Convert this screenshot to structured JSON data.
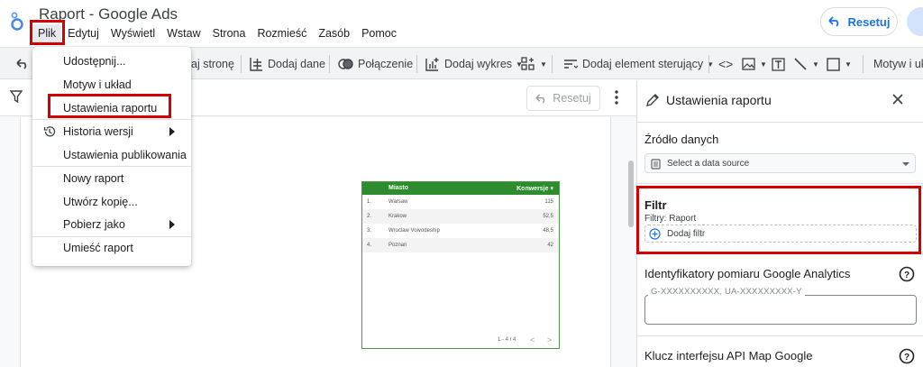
{
  "app": {
    "title": "Raport - Google Ads",
    "reset_label": "Resetuj"
  },
  "menubar": [
    "Plik",
    "Edytuj",
    "Wyświetl",
    "Wstaw",
    "Strona",
    "Rozmieść",
    "Zasób",
    "Pomoc"
  ],
  "toolbar": {
    "add_page": "aj stronę",
    "add_data": "Dodaj dane",
    "connection": "Połączenie",
    "add_chart": "Dodaj wykres",
    "add_control": "Dodaj element sterujący",
    "theme": "Motyw i ukł"
  },
  "canvas": {
    "reset_label": "Resetuj"
  },
  "file_menu": {
    "items": [
      {
        "label": "Udostępnij...",
        "submenu": false,
        "icon": ""
      },
      {
        "label": "Motyw i układ",
        "submenu": false,
        "icon": ""
      },
      {
        "label": "Ustawienia raportu",
        "submenu": false,
        "icon": ""
      },
      {
        "label": "Historia wersji",
        "submenu": true,
        "icon": "history-icon"
      },
      {
        "label": "Ustawienia publikowania",
        "submenu": false,
        "icon": ""
      },
      {
        "label": "Nowy raport",
        "submenu": false,
        "icon": ""
      },
      {
        "label": "Utwórz kopię...",
        "submenu": false,
        "icon": ""
      },
      {
        "label": "Pobierz jako",
        "submenu": true,
        "icon": ""
      },
      {
        "label": "Umieść raport",
        "submenu": false,
        "icon": ""
      }
    ]
  },
  "table": {
    "headers": [
      "Miasto",
      "Konwersje"
    ],
    "rows": [
      {
        "no": "1.",
        "city": "Warsaw",
        "value": "115"
      },
      {
        "no": "2.",
        "city": "Krakow",
        "value": "52,5"
      },
      {
        "no": "3.",
        "city": "Wroclaw Voivodeship",
        "value": "48,5"
      },
      {
        "no": "4.",
        "city": "Poznan",
        "value": "42"
      }
    ],
    "pager": "1 - 4 / 4",
    "accent_color": "#2e8b2e"
  },
  "panel": {
    "title": "Ustawienia raportu",
    "data_source_label": "Źródło danych",
    "data_source_placeholder": "Select a data source",
    "filter_label": "Filtr",
    "filter_sub": "Filtry: Raport",
    "add_filter": "Dodaj filtr",
    "ga_label": "Identyfikatory pomiaru Google Analytics",
    "ga_placeholder": "G-XXXXXXXXXX, UA-XXXXXXXXX-Y",
    "maps_label": "Klucz interfejsu API Map Google"
  },
  "colors": {
    "highlight": "#d40000",
    "accent": "#1a73e8"
  }
}
